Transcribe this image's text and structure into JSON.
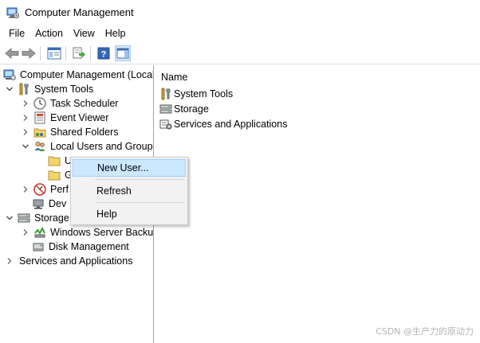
{
  "window": {
    "title": "Computer Management",
    "icon": "computer-management-icon"
  },
  "menu": [
    "File",
    "Action",
    "View",
    "Help"
  ],
  "toolbar": {
    "buttons": [
      "back-arrow-icon",
      "forward-arrow-icon",
      "show-hide-console-tree-icon",
      "export-list-icon",
      "help-icon",
      "show-hide-action-pane-icon"
    ]
  },
  "tree": {
    "root": "Computer Management (Local",
    "system_tools": "System Tools",
    "task_scheduler": "Task Scheduler",
    "event_viewer": "Event Viewer",
    "shared_folders": "Shared Folders",
    "local_users_groups": "Local Users and Groups",
    "users_partial": "U",
    "groups_partial": "G",
    "performance_partial": "Perf",
    "device_partial": "Dev",
    "storage": "Storage",
    "windows_server_backup": "Windows Server Backup",
    "disk_management": "Disk Management",
    "services_apps": "Services and Applications"
  },
  "right": {
    "header": "Name",
    "items": [
      "System Tools",
      "Storage",
      "Services and Applications"
    ]
  },
  "context_menu": {
    "new_user": "New User...",
    "refresh": "Refresh",
    "help": "Help"
  },
  "watermark": "CSDN @生产力的原动力",
  "colors": {
    "hover_bg": "#cce8ff",
    "hover_border": "#99d1ff",
    "menu_bg": "#f2f2f2",
    "folder": "#f4d46a"
  }
}
